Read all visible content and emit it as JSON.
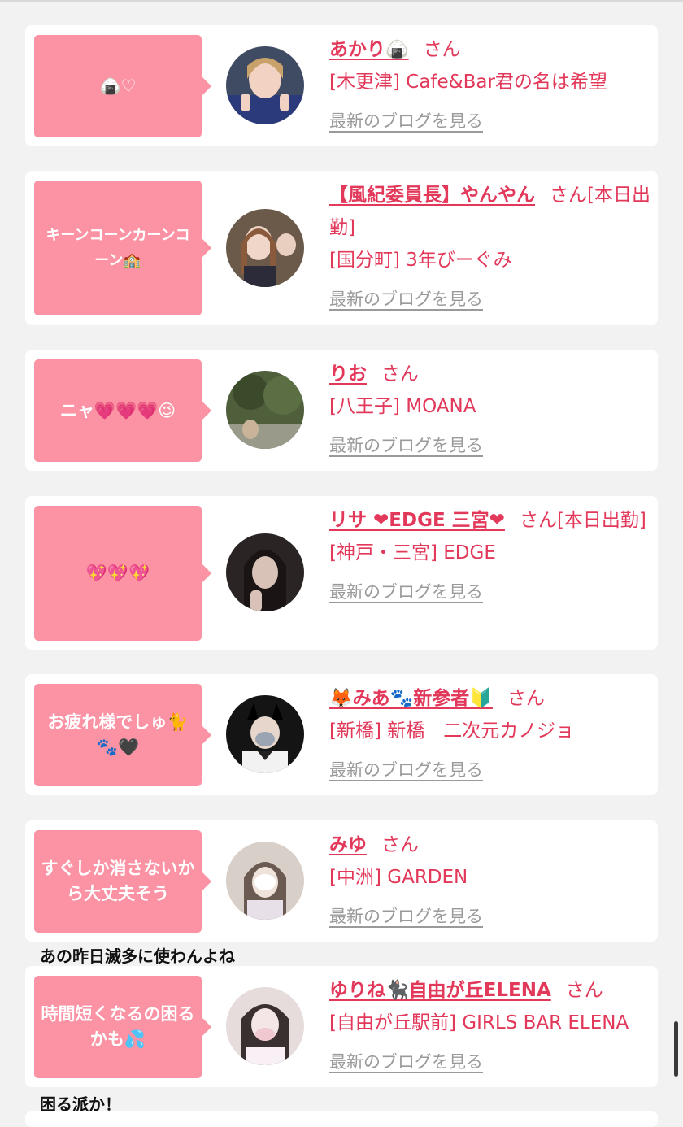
{
  "blog_link_label": "最新のブログを見る",
  "cards": [
    {
      "bubble": "🍙♡",
      "name": "あかり🍙",
      "suffix": "さん",
      "shop": "[木更津] Cafe&Bar君の名は希望"
    },
    {
      "bubble": "キーンコーンカーンコーン🏫",
      "name": "【風紀委員長】やんやん",
      "suffix": "さん[本日出勤]",
      "shop": "[国分町] 3年びーぐみ"
    },
    {
      "bubble": "ニャ💗💗💗😉",
      "name": "りお",
      "suffix": "さん",
      "shop": "[八王子] MOANA"
    },
    {
      "bubble": "💖💖💖",
      "name": "リサ ❤EDGE 三宮❤",
      "suffix": "さん[本日出勤]",
      "shop": "[神戸・三宮] EDGE"
    },
    {
      "bubble": "お疲れ様でしゅ🐈🐾🖤",
      "name": "🦊みあ🐾新参者🔰",
      "suffix": "さん",
      "shop": "[新橋] 新橋　二次元カノジョ"
    },
    {
      "bubble": "すぐしか消さないから大丈夫そう",
      "name": "みゆ",
      "suffix": "さん",
      "shop": "[中洲] GARDEN"
    },
    {
      "bubble": "時間短くなるの困るかも💦",
      "name": "ゆりね🐈‍⬛自由が丘ELENA",
      "suffix": "さん",
      "shop": "[自由が丘駅前] GIRLS BAR ELENA"
    }
  ],
  "comments": [
    "あの昨日滅多に使わんよね",
    "困る派か！"
  ],
  "colors": {
    "bubble": "#fb93a4",
    "name": "#e2385a",
    "link": "#9a9a9a",
    "background": "#f2f2f2"
  }
}
